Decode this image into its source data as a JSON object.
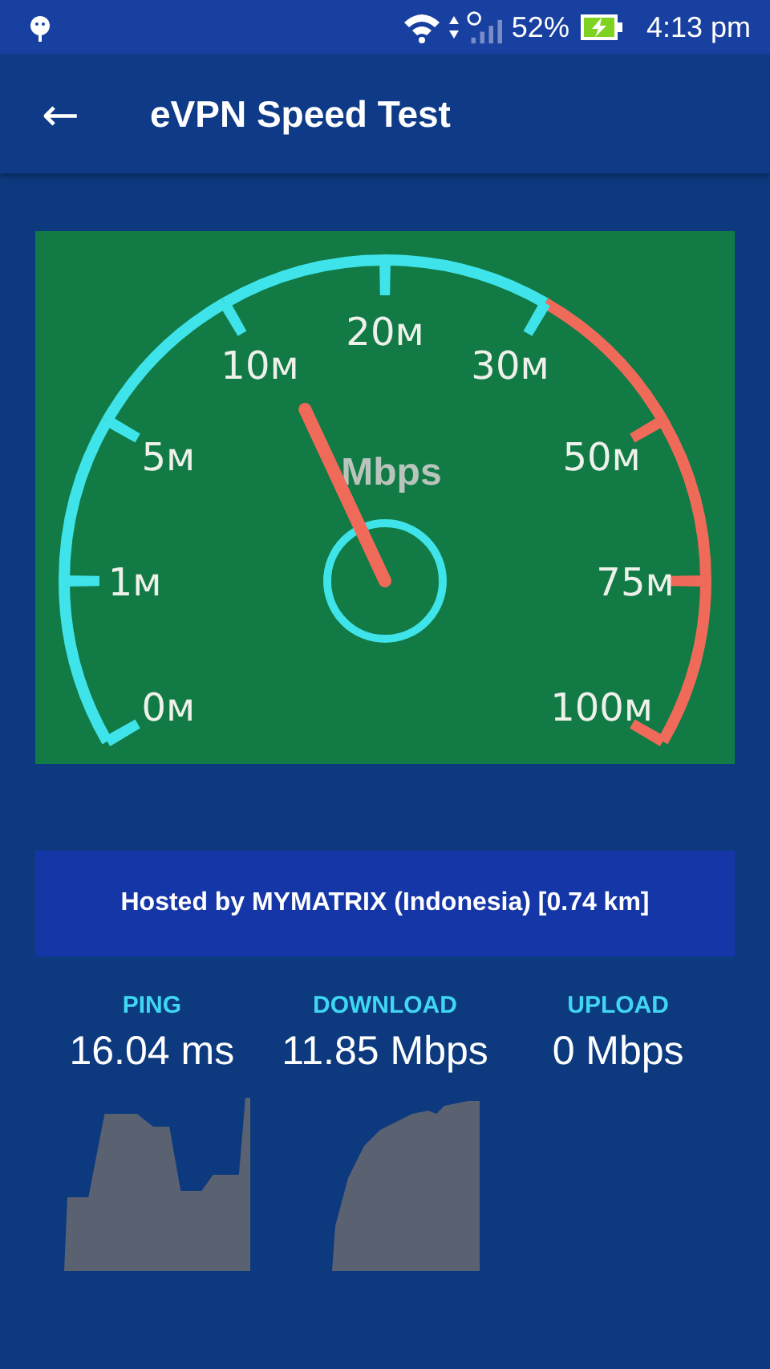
{
  "status_bar": {
    "battery": "52%",
    "time": "4:13 pm"
  },
  "app_bar": {
    "back": "←",
    "title": "eVPN Speed Test"
  },
  "gauge": {
    "unit": "Mbps",
    "ticks": [
      {
        "label": "0м",
        "color": "#3fe3ea"
      },
      {
        "label": "1м",
        "color": "#3fe3ea"
      },
      {
        "label": "5м",
        "color": "#3fe3ea"
      },
      {
        "label": "10м",
        "color": "#3fe3ea"
      },
      {
        "label": "20м",
        "color": "#3fe3ea"
      },
      {
        "label": "30м",
        "color": "#3fe3ea"
      },
      {
        "label": "50м",
        "color": "#f06a5a"
      },
      {
        "label": "75м",
        "color": "#f06a5a"
      },
      {
        "label": "100м",
        "color": "#f06a5a"
      }
    ]
  },
  "server": "Hosted by MYMATRIX (Indonesia) [0.74 km]",
  "results": [
    {
      "kind": "ping",
      "label": "PING",
      "value": "16.04 ms"
    },
    {
      "kind": "download",
      "label": "DOWNLOAD",
      "value": "11.85 Mbps"
    },
    {
      "kind": "upload",
      "label": "UPLOAD",
      "value": "0 Mbps"
    }
  ]
}
